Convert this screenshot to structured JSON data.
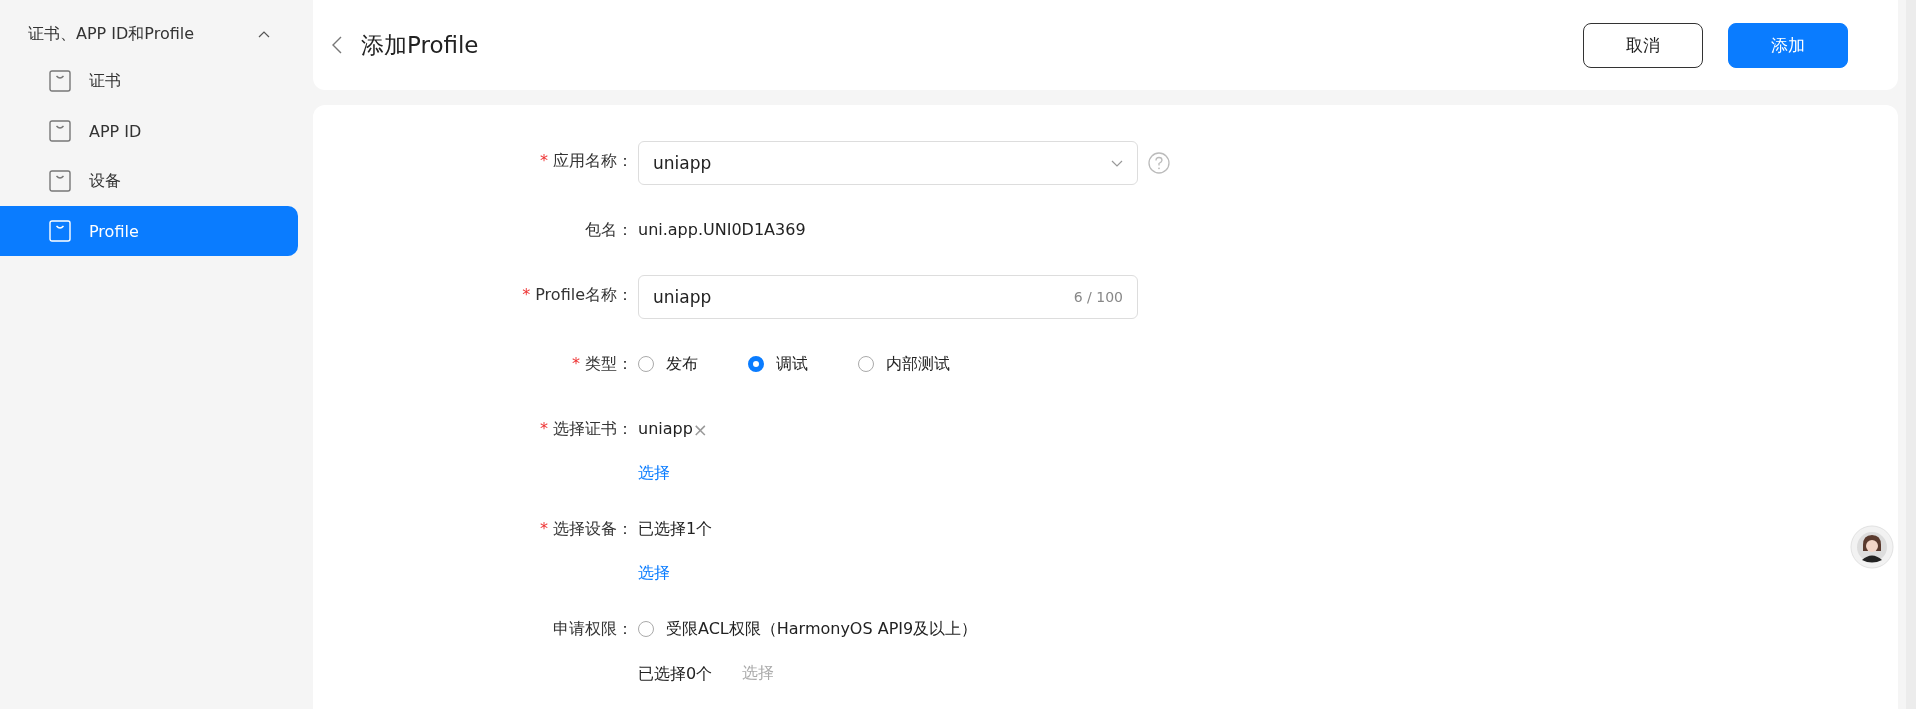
{
  "sidebar": {
    "group": {
      "label": "证书、APP ID和Profile",
      "expanded": true
    },
    "items": [
      {
        "label": "证书",
        "selected": false
      },
      {
        "label": "APP ID",
        "selected": false
      },
      {
        "label": "设备",
        "selected": false
      },
      {
        "label": "Profile",
        "selected": true
      }
    ]
  },
  "header": {
    "title": "添加Profile",
    "buttons": [
      {
        "label": "取消",
        "kind": "secondary"
      },
      {
        "label": "添加",
        "kind": "primary"
      }
    ]
  },
  "form": {
    "fields": [
      {
        "kind": "select",
        "label": "应用名称：",
        "marker": "*",
        "value": "uniapp"
      },
      {
        "kind": "text",
        "label": "包名：",
        "value": "uni.app.UNI0D1A369"
      },
      {
        "kind": "input",
        "label": "Profile名称：",
        "marker": "*",
        "value": "uniapp",
        "counter": "6 / 100"
      },
      {
        "kind": "radio",
        "label": "类型：",
        "marker": "*",
        "options": [
          {
            "label": "发布",
            "selected": false
          },
          {
            "label": "调试",
            "selected": true
          },
          {
            "label": "内部测试",
            "selected": false
          }
        ]
      },
      {
        "kind": "tag",
        "label": "选择证书：",
        "marker": "*",
        "tag": "uniapp",
        "remove": "×",
        "link": "选择",
        "link_disabled": false
      },
      {
        "kind": "summary",
        "label": "选择设备：",
        "marker": "*",
        "value": "已选择1个",
        "link": "选择",
        "link_disabled": false
      },
      {
        "kind": "options",
        "label": "申请权限：",
        "options": [
          {
            "label": "受限ACL权限（HarmonyOS API9及以上）",
            "selected": false
          }
        ],
        "value": "已选择0个",
        "link": "选择",
        "link_disabled": true
      }
    ]
  }
}
